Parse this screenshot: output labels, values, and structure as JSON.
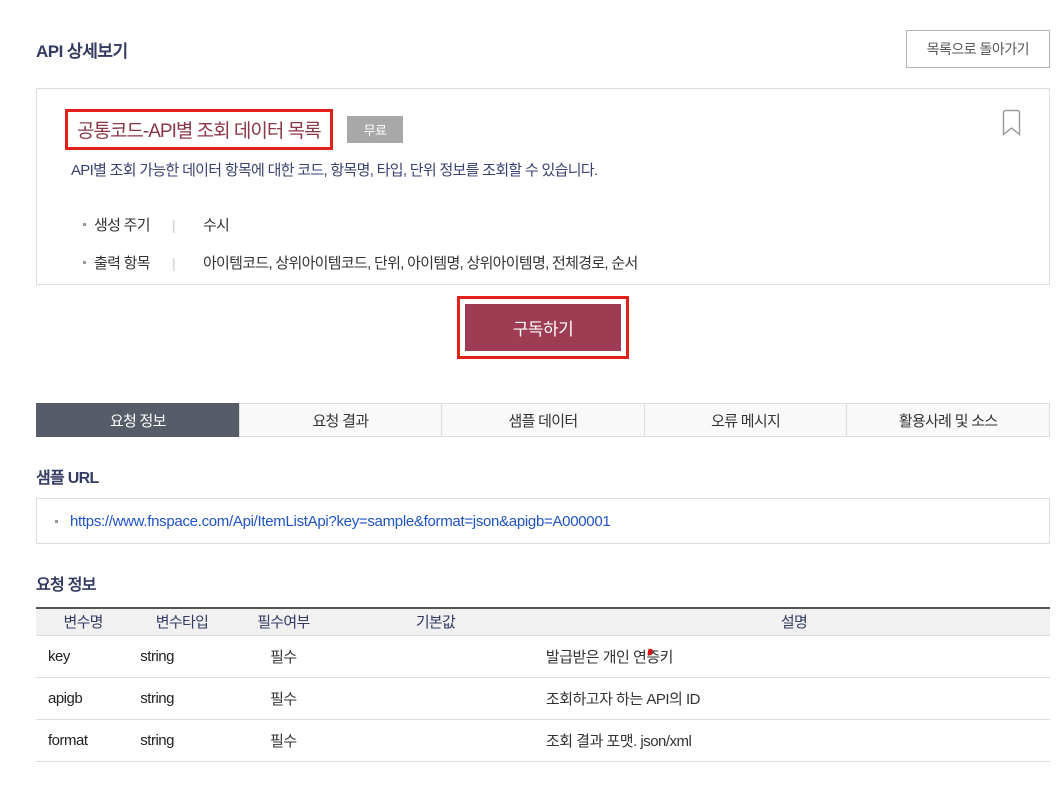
{
  "page": {
    "title": "API 상세보기"
  },
  "header": {
    "back_button_label": "목록으로 돌아가기"
  },
  "api_info": {
    "title": "공통코드-API별 조회 데이터 목록",
    "badge": "무료",
    "description": "API별 조회 가능한 데이터 항목에 대한 코드, 항목명, 타입, 단위 정보를 조회할 수 있습니다.",
    "meta": [
      {
        "label": "생성 주기",
        "divider": "|",
        "value": "수시"
      },
      {
        "label": "출력 항목",
        "divider": "|",
        "value": "아이템코드, 상위아이템코드, 단위, 아이템명, 상위아이템명, 전체경로, 순서"
      }
    ],
    "bookmark_icon": "bookmark-outline"
  },
  "subscribe": {
    "label": "구독하기"
  },
  "tabs": {
    "items": [
      {
        "label": "요청 정보",
        "active": true
      },
      {
        "label": "요청 결과",
        "active": false
      },
      {
        "label": "샘플 데이터",
        "active": false
      },
      {
        "label": "오류 메시지",
        "active": false
      },
      {
        "label": "활용사례 및 소스",
        "active": false
      }
    ]
  },
  "sample_url": {
    "heading": "샘플 URL",
    "url": "https://www.fnspace.com/Api/ItemListApi?key=sample&format=json&apigb=A000001"
  },
  "request_info": {
    "heading": "요청 정보",
    "columns": [
      "변수명",
      "변수타입",
      "필수여부",
      "기본값",
      "설명"
    ],
    "rows": [
      {
        "name": "key",
        "type": "string",
        "required": "필수",
        "default": "",
        "description": "발급받은 개인 연증키",
        "red_spell_mark": true
      },
      {
        "name": "apigb",
        "type": "string",
        "required": "필수",
        "default": "",
        "description": "조회하고자 하는 API의 ID",
        "red_spell_mark": false
      },
      {
        "name": "format",
        "type": "string",
        "required": "필수",
        "default": "",
        "description": "조회 결과 포맷. json/xml",
        "red_spell_mark": false
      }
    ]
  },
  "annotations": {
    "highlight_color": "#e32119",
    "highlighted_items": [
      "api-title",
      "subscribe-button"
    ]
  },
  "colors": {
    "accent": "#9d3c53",
    "title_text": "#8a3747",
    "heading_text": "#333b62",
    "active_tab_bg": "#575d68",
    "link": "#1f53c5",
    "badge_bg": "#a8a8a8"
  }
}
